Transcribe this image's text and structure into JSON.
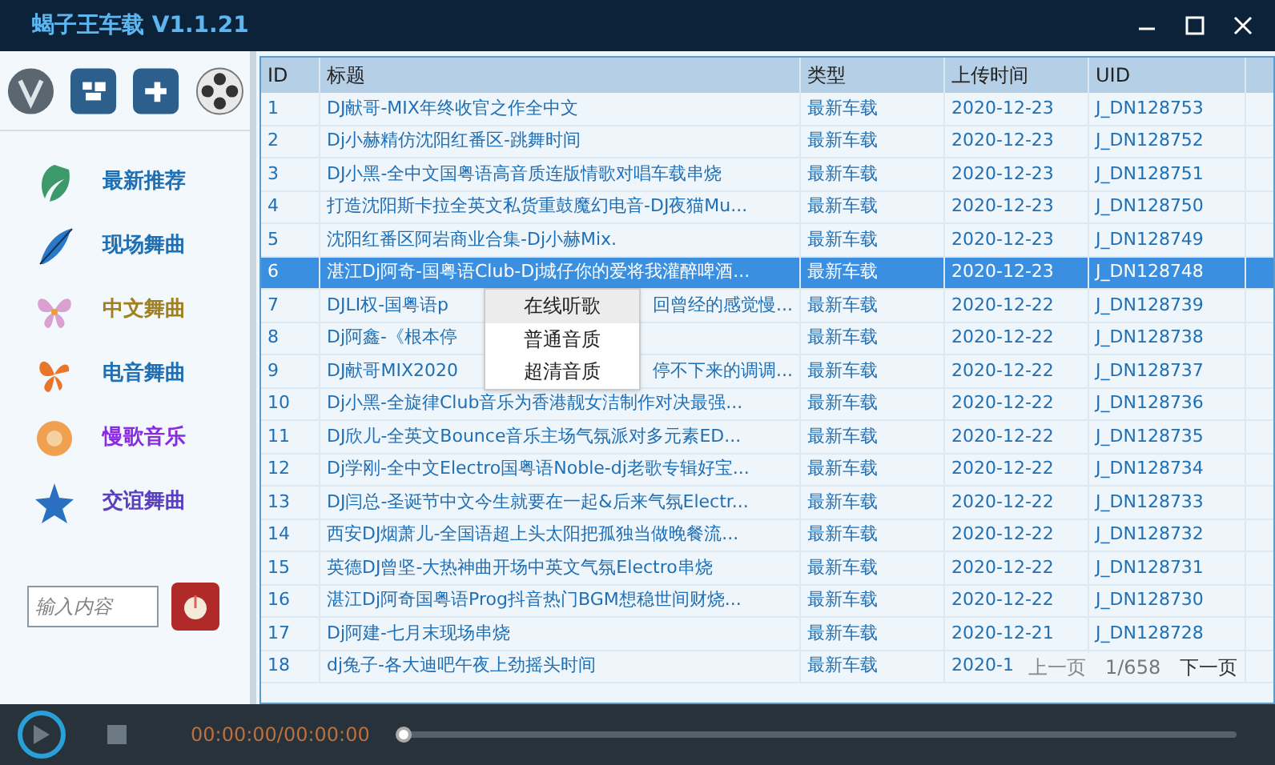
{
  "window": {
    "title": "蝎子王车载 V1.1.21"
  },
  "nav": [
    {
      "label": "最新推荐",
      "color": "#1f6fb5"
    },
    {
      "label": "现场舞曲",
      "color": "#1f6fb5"
    },
    {
      "label": "中文舞曲",
      "color": "#a08020"
    },
    {
      "label": "电音舞曲",
      "color": "#1f6fb5"
    },
    {
      "label": "慢歌音乐",
      "color": "#8a2be2"
    },
    {
      "label": "交谊舞曲",
      "color": "#5a3fc0"
    }
  ],
  "search": {
    "placeholder": "输入内容"
  },
  "table": {
    "columns": [
      "ID",
      "标题",
      "类型",
      "上传时间",
      "UID"
    ],
    "rows": [
      {
        "id": "1",
        "title": "DJ献哥-MIX年终收官之作全中文",
        "type": "最新车载",
        "date": "2020-12-23",
        "uid": "J_DN128753",
        "selected": false
      },
      {
        "id": "2",
        "title": "Dj小赫精仿沈阳红番区-跳舞时间",
        "type": "最新车载",
        "date": "2020-12-23",
        "uid": "J_DN128752",
        "selected": false
      },
      {
        "id": "3",
        "title": "DJ小黑-全中文国粤语高音质连版情歌对唱车载串烧",
        "type": "最新车载",
        "date": "2020-12-23",
        "uid": "J_DN128751",
        "selected": false
      },
      {
        "id": "4",
        "title": "打造沈阳斯卡拉全英文私货重鼓魔幻电音-DJ夜猫Mu...",
        "type": "最新车载",
        "date": "2020-12-23",
        "uid": "J_DN128750",
        "selected": false
      },
      {
        "id": "5",
        "title": "沈阳红番区阿岩商业合集-Dj小赫Mix.",
        "type": "最新车载",
        "date": "2020-12-23",
        "uid": "J_DN128749",
        "selected": false
      },
      {
        "id": "6",
        "title": "湛江Dj阿奇-国粤语Club-Dj城仔你的爱将我灌醉啤酒...",
        "type": "最新车载",
        "date": "2020-12-23",
        "uid": "J_DN128748",
        "selected": true
      },
      {
        "id": "7",
        "title": "DJLI权-国粤语p",
        "title_end": "回曾经的感觉慢...",
        "type": "最新车载",
        "date": "2020-12-22",
        "uid": "J_DN128739",
        "selected": false
      },
      {
        "id": "8",
        "title": "Dj阿鑫-《根本停",
        "type": "最新车载",
        "date": "2020-12-22",
        "uid": "J_DN128738",
        "selected": false
      },
      {
        "id": "9",
        "title": "DJ献哥MIX2020",
        "title_end": "停不下来的调调...",
        "type": "最新车载",
        "date": "2020-12-22",
        "uid": "J_DN128737",
        "selected": false
      },
      {
        "id": "10",
        "title": "Dj小黑-全旋律Club音乐为香港靓女洁制作对决最强...",
        "type": "最新车载",
        "date": "2020-12-22",
        "uid": "J_DN128736",
        "selected": false
      },
      {
        "id": "11",
        "title": "DJ欣儿-全英文Bounce音乐主场气氛派对多元素ED...",
        "type": "最新车载",
        "date": "2020-12-22",
        "uid": "J_DN128735",
        "selected": false
      },
      {
        "id": "12",
        "title": "Dj学刚-全中文Electro国粤语Noble-dj老歌专辑好宝...",
        "type": "最新车载",
        "date": "2020-12-22",
        "uid": "J_DN128734",
        "selected": false
      },
      {
        "id": "13",
        "title": "DJ闫总-圣诞节中文今生就要在一起&后来气氛Electr...",
        "type": "最新车载",
        "date": "2020-12-22",
        "uid": "J_DN128733",
        "selected": false
      },
      {
        "id": "14",
        "title": "西安DJ烟萧儿-全国语超上头太阳把孤独当做晚餐流...",
        "type": "最新车载",
        "date": "2020-12-22",
        "uid": "J_DN128732",
        "selected": false
      },
      {
        "id": "15",
        "title": "英德DJ曾坚-大热神曲开场中英文气氛Electro串烧",
        "type": "最新车载",
        "date": "2020-12-22",
        "uid": "J_DN128731",
        "selected": false
      },
      {
        "id": "16",
        "title": "湛江Dj阿奇国粤语Prog抖音热门BGM想稳世间财烧...",
        "type": "最新车载",
        "date": "2020-12-22",
        "uid": "J_DN128730",
        "selected": false
      },
      {
        "id": "17",
        "title": "Dj阿建-七月末现场串烧",
        "type": "最新车载",
        "date": "2020-12-21",
        "uid": "J_DN128728",
        "selected": false
      },
      {
        "id": "18",
        "title": "dj兔子-各大迪吧午夜上劲摇头时间",
        "type": "最新车载",
        "date": "2020-1",
        "selected": false
      }
    ]
  },
  "context_menu": [
    {
      "label": "在线听歌",
      "selected": true
    },
    {
      "label": "普通音质",
      "selected": false
    },
    {
      "label": "超清音质",
      "selected": false
    }
  ],
  "pager": {
    "prev": "上一页",
    "page": "1/658",
    "next": "下一页"
  },
  "player": {
    "time": "00:00:00/00:00:00",
    "level": 0
  }
}
